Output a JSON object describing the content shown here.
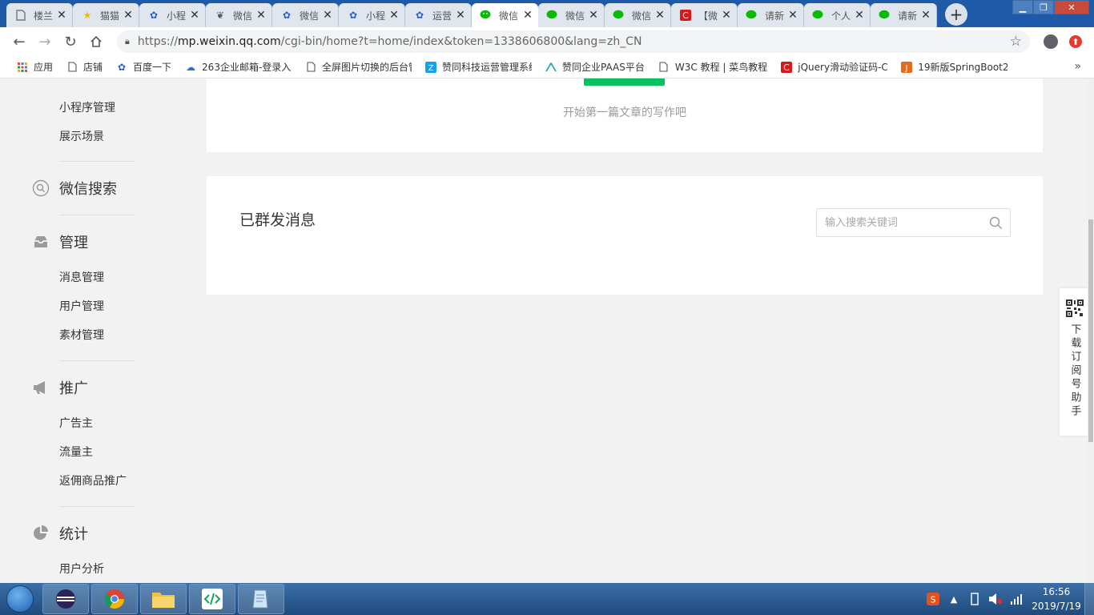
{
  "browser": {
    "tabs": [
      {
        "label": "楼兰",
        "icon": "page-icon",
        "active": false
      },
      {
        "label": "猫猫",
        "icon": "star-icon",
        "active": false
      },
      {
        "label": "小程",
        "icon": "baidu-paw-icon",
        "active": false
      },
      {
        "label": "微信",
        "icon": "dev-tool-icon",
        "active": false
      },
      {
        "label": "微信",
        "icon": "baidu-paw-icon",
        "active": false
      },
      {
        "label": "小程",
        "icon": "baidu-paw-icon",
        "active": false
      },
      {
        "label": "运营",
        "icon": "baidu-paw-icon",
        "active": false
      },
      {
        "label": "微信",
        "icon": "wechat-icon",
        "active": true
      },
      {
        "label": "微信",
        "icon": "wechat-icon",
        "active": false
      },
      {
        "label": "微信",
        "icon": "wechat-icon",
        "active": false
      },
      {
        "label": "【微",
        "icon": "csdn-icon",
        "active": false
      },
      {
        "label": "请新",
        "icon": "wechat-icon",
        "active": false
      },
      {
        "label": "个人",
        "icon": "wechat-icon",
        "active": false
      },
      {
        "label": "请新",
        "icon": "wechat-icon",
        "active": false
      }
    ],
    "url_prefix": "https://",
    "url_host": "mp.weixin.qq.com",
    "url_path": "/cgi-bin/home?t=home/index&token=1338606800&lang=zh_CN",
    "bookmarks": [
      {
        "label": "应用",
        "icon": "apps-grid-icon"
      },
      {
        "label": "店铺",
        "icon": "page-icon"
      },
      {
        "label": "百度一下",
        "icon": "baidu-paw-icon"
      },
      {
        "label": "263企业邮箱-登录入口",
        "icon": "cloud-mail-icon"
      },
      {
        "label": "全屏图片切换的后台管",
        "icon": "page-icon"
      },
      {
        "label": "赞同科技运营管理系统",
        "icon": "zt-logo-icon"
      },
      {
        "label": "赞同企业PAAS平台",
        "icon": "paas-logo-icon"
      },
      {
        "label": "W3C 教程 | 菜鸟教程",
        "icon": "page-icon"
      },
      {
        "label": "jQuery滑动验证码-C",
        "icon": "csdn-icon"
      },
      {
        "label": "19新版SpringBoot2",
        "icon": "jm-logo-icon"
      }
    ],
    "bookmarks_more": "»"
  },
  "sidebar": {
    "items_top": [
      "小程序管理",
      "展示场景"
    ],
    "sections": [
      {
        "title": "微信搜索",
        "icon": "wechat-search-icon",
        "items": []
      },
      {
        "title": "管理",
        "icon": "inbox-icon",
        "items": [
          "消息管理",
          "用户管理",
          "素材管理"
        ]
      },
      {
        "title": "推广",
        "icon": "megaphone-icon",
        "items": [
          "广告主",
          "流量主",
          "返佣商品推广"
        ]
      },
      {
        "title": "统计",
        "icon": "pie-chart-icon",
        "items": [
          "用户分析"
        ]
      }
    ]
  },
  "main": {
    "start_hint": "开始第一篇文章的写作吧",
    "sent_title": "已群发消息",
    "search_placeholder": "输入搜索关键词"
  },
  "helper": {
    "text": "下载订阅号助手"
  },
  "taskbar": {
    "time": "16:56",
    "date": "2019/7/19"
  },
  "colors": {
    "tab_strip": "#1e5aa8",
    "wechat_green": "#07c160",
    "page_bg": "#f2f2f2"
  }
}
